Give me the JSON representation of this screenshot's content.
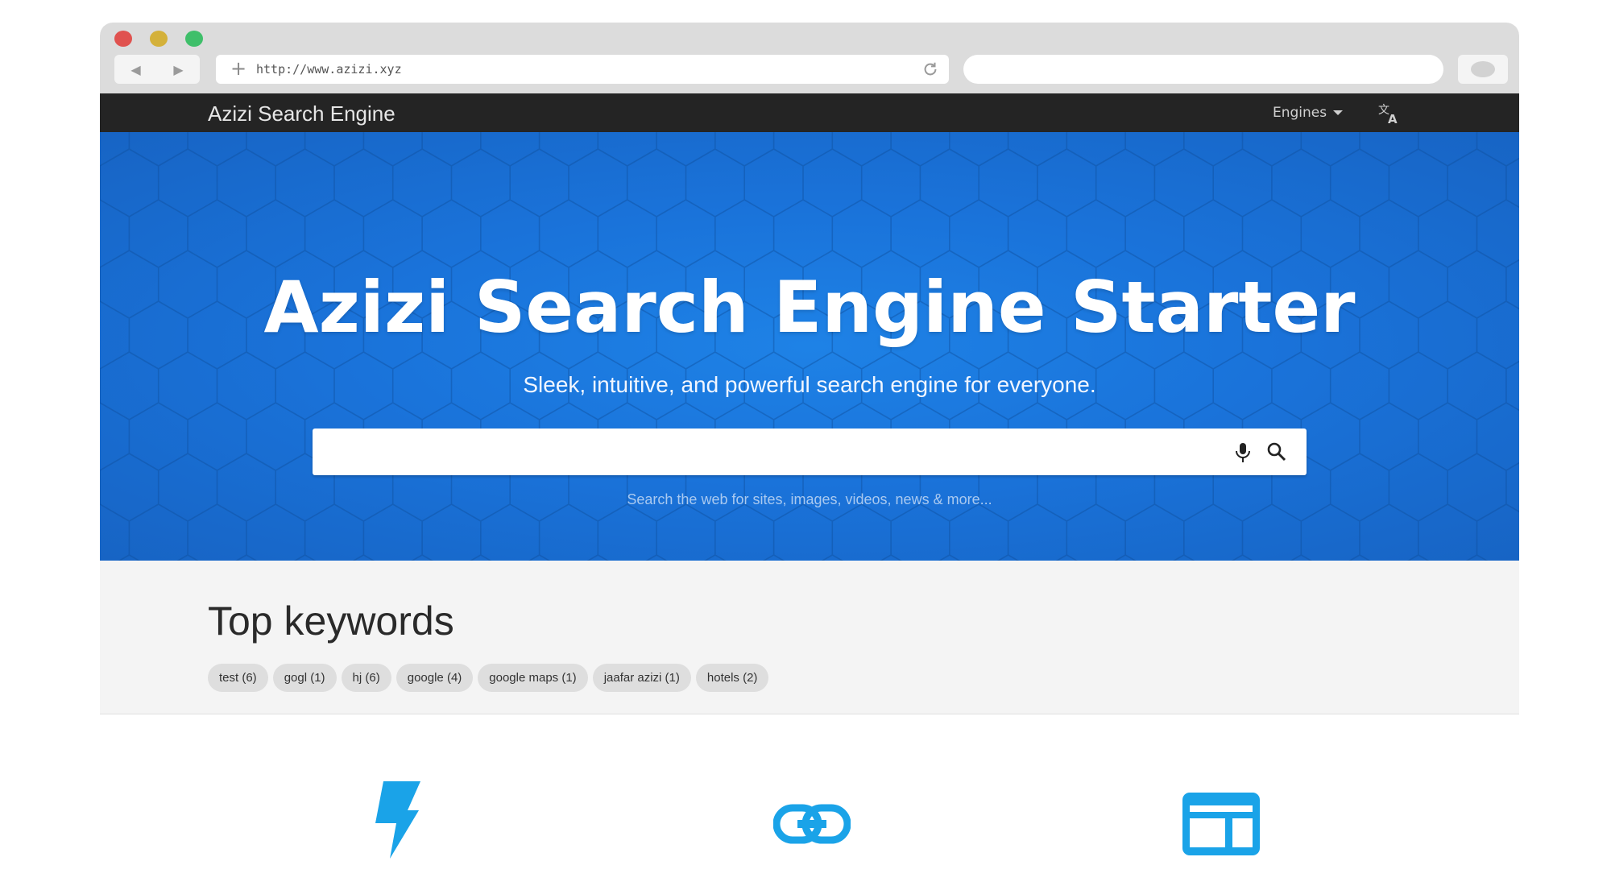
{
  "browser": {
    "url": "http://www.azizi.xyz",
    "back_icon": "back-arrow-icon",
    "forward_icon": "forward-arrow-icon"
  },
  "navbar": {
    "brand": "Azizi Search Engine",
    "engines_label": "Engines",
    "translate_icon": "translate-icon"
  },
  "hero": {
    "title": "Azizi Search Engine Starter",
    "subtitle": "Sleek, intuitive, and powerful search engine for everyone.",
    "search_placeholder": "",
    "hint": "Search the web for sites, images, videos, news & more..."
  },
  "keywords": {
    "title": "Top keywords",
    "items": [
      "test (6)",
      "gogl (1)",
      "hj (6)",
      "google (4)",
      "google maps (1)",
      "jaafar azizi (1)",
      "hotels (2)"
    ]
  },
  "features": {
    "icons": [
      "lightning-icon",
      "link-icon",
      "layout-icon"
    ],
    "accent": "#1aa3e8"
  },
  "colors": {
    "hero_blue": "#1a73da",
    "navbar": "#242424",
    "chrome": "#dcdcdc"
  }
}
